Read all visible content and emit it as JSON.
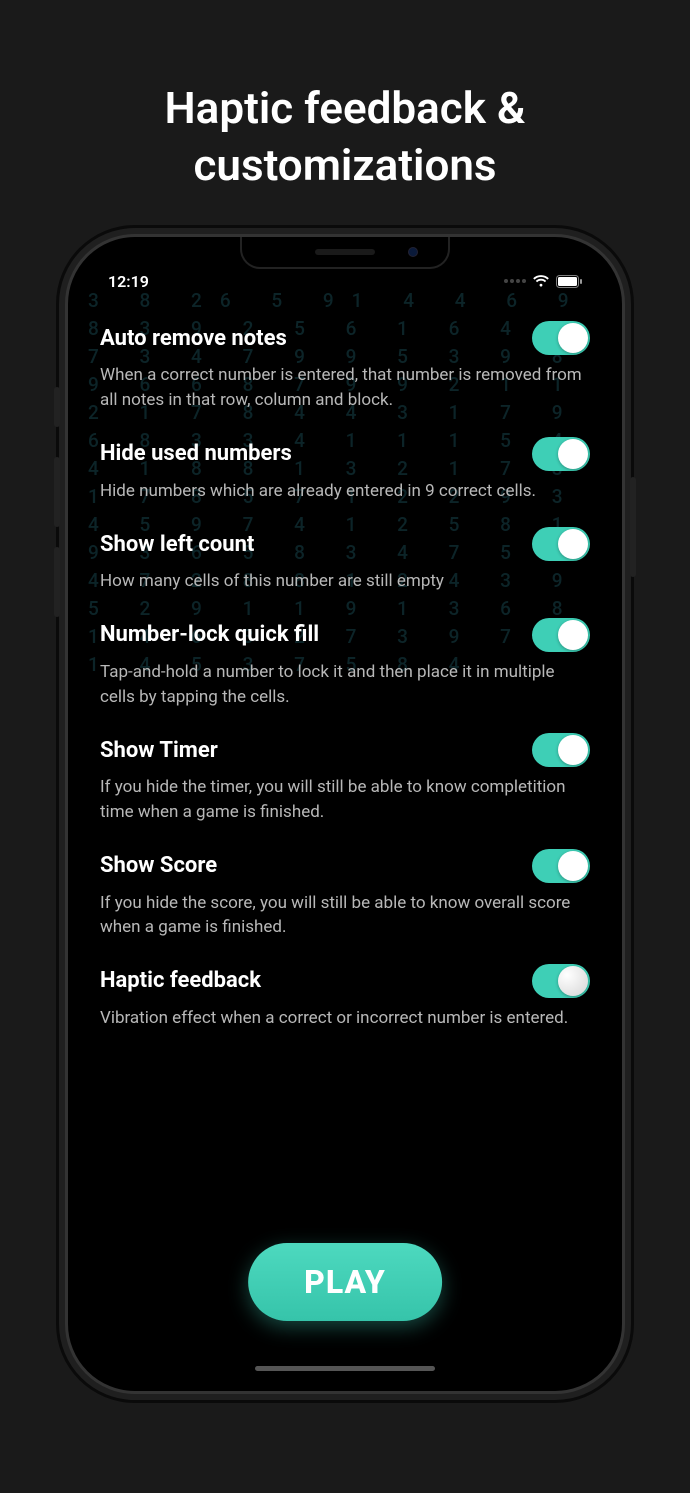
{
  "promo_title": "Haptic feedback & customizations",
  "status": {
    "time": "12:19"
  },
  "settings": [
    {
      "title": "Auto remove notes",
      "desc": "When a correct number is entered, that number is removed from all notes in that row, column and block.",
      "on": true
    },
    {
      "title": "Hide used numbers",
      "desc": "Hide numbers which are already entered in 9 correct cells.",
      "on": true
    },
    {
      "title": "Show left count",
      "desc": "How many cells of this number are still empty",
      "on": true
    },
    {
      "title": "Number-lock quick fill",
      "desc": "Tap-and-hold a number to lock it and then place it in multiple cells by tapping the cells.",
      "on": true
    },
    {
      "title": "Show Timer",
      "desc": "If you hide the timer, you will still be able to know completition time when a game is finished.",
      "on": true
    },
    {
      "title": "Show Score",
      "desc": "If you hide the score, you will still be able to know overall score when a game is finished.",
      "on": true
    },
    {
      "title": "Haptic feedback",
      "desc": "Vibration effect when a correct or incorrect number is entered.",
      "on": true
    }
  ],
  "play_label": "PLAY",
  "bg_numbers": "3 8 26 5 91 4 4 6 9 8 3 9 2 5 6 1 6 4 9 7 3 4 7 9 9 5 3 9 8 9 6 6 8 7 9 9 2 1 1 2 1 7 8 4 4 3 1 7 9 6 8 3 3 4 1 1 1 5 4 4 1 8 8 1 3 2 1 7 3 1 7 8 5 7 1 2 2 9 3 4 5 9 7 4 1 2 5 8 1 9 3 6 5 8 3 4 7 5 2 4 7 2 8 8 1 2 4 3 9 5 2 9 1 1 9 1 3 6 8 1 4 6 3 2 7 3 9 7 2 1 4 5 3 7 5 8 4"
}
